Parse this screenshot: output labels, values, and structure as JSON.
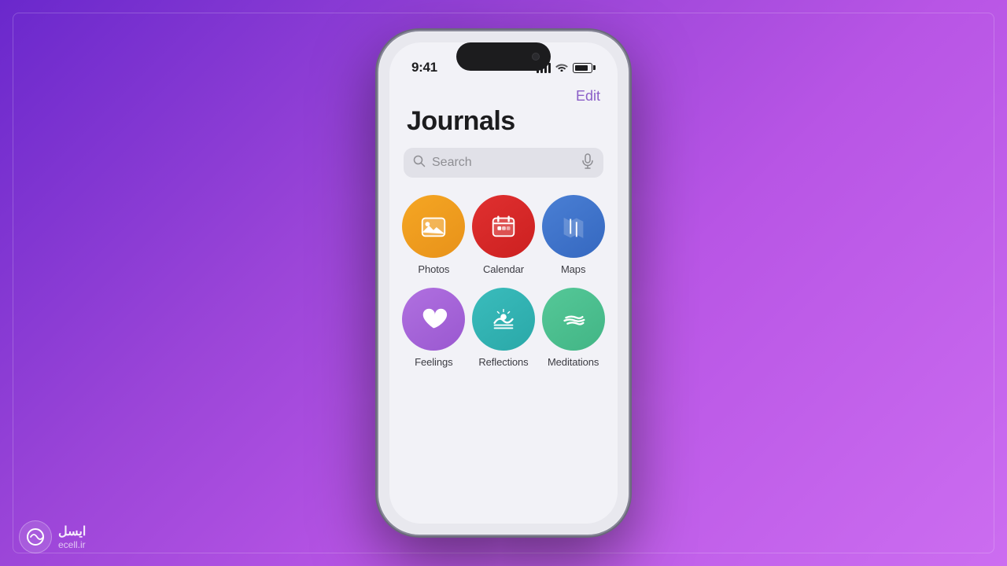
{
  "background": {
    "gradient_start": "#6A28CC",
    "gradient_end": "#CC6DF0"
  },
  "status_bar": {
    "time": "9:41",
    "signal_label": "signal",
    "wifi_label": "wifi",
    "battery_label": "battery"
  },
  "header": {
    "edit_label": "Edit",
    "title": "Journals"
  },
  "search": {
    "placeholder": "Search"
  },
  "apps": [
    {
      "id": "photos",
      "label": "Photos",
      "color_class": "icon-photos",
      "icon_type": "photos"
    },
    {
      "id": "calendar",
      "label": "Calendar",
      "color_class": "icon-calendar",
      "icon_type": "calendar"
    },
    {
      "id": "maps",
      "label": "Maps",
      "color_class": "icon-maps",
      "icon_type": "maps"
    },
    {
      "id": "feelings",
      "label": "Feelings",
      "color_class": "icon-feelings",
      "icon_type": "feelings"
    },
    {
      "id": "reflections",
      "label": "Reflections",
      "color_class": "icon-reflections",
      "icon_type": "reflections"
    },
    {
      "id": "meditations",
      "label": "Meditations",
      "color_class": "icon-meditations",
      "icon_type": "meditations"
    }
  ],
  "watermark": {
    "site": "ecell.ir",
    "arabic_text": "ایسل"
  }
}
